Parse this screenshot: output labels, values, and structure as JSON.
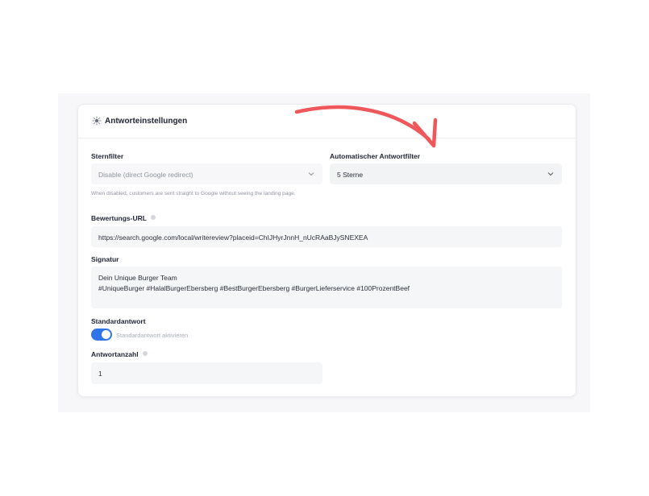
{
  "panel": {
    "title": "Antworteinstellungen",
    "header_icon": "settings-sparkle-icon"
  },
  "star_filter": {
    "label": "Sternfilter",
    "value": "Disable (direct Google redirect)",
    "hint": "When disabled, customers are sent straight to Google without seeing the landing page."
  },
  "auto_reply_filter": {
    "label": "Automatischer Antwortfilter",
    "value": "5 Sterne"
  },
  "review_url": {
    "label": "Bewertungs-URL",
    "value": "https://search.google.com/local/writereview?placeid=ChIJHyrJnnH_nUcRAaBJySNEXEA"
  },
  "signature": {
    "label": "Signatur",
    "line1": "Dein Unique Burger Team",
    "line2": "#UniqueBurger #HalalBurgerEbersberg #BestBurgerEbersberg #BurgerLieferservice #100ProzentBeef"
  },
  "default_reply": {
    "label": "Standardantwort",
    "toggle_label": "Standardantwort aktivieren",
    "enabled": true
  },
  "reply_count": {
    "label": "Antwortanzahl",
    "value": "1"
  },
  "colors": {
    "accent": "#2f74e9",
    "arrow": "#f0575a"
  }
}
